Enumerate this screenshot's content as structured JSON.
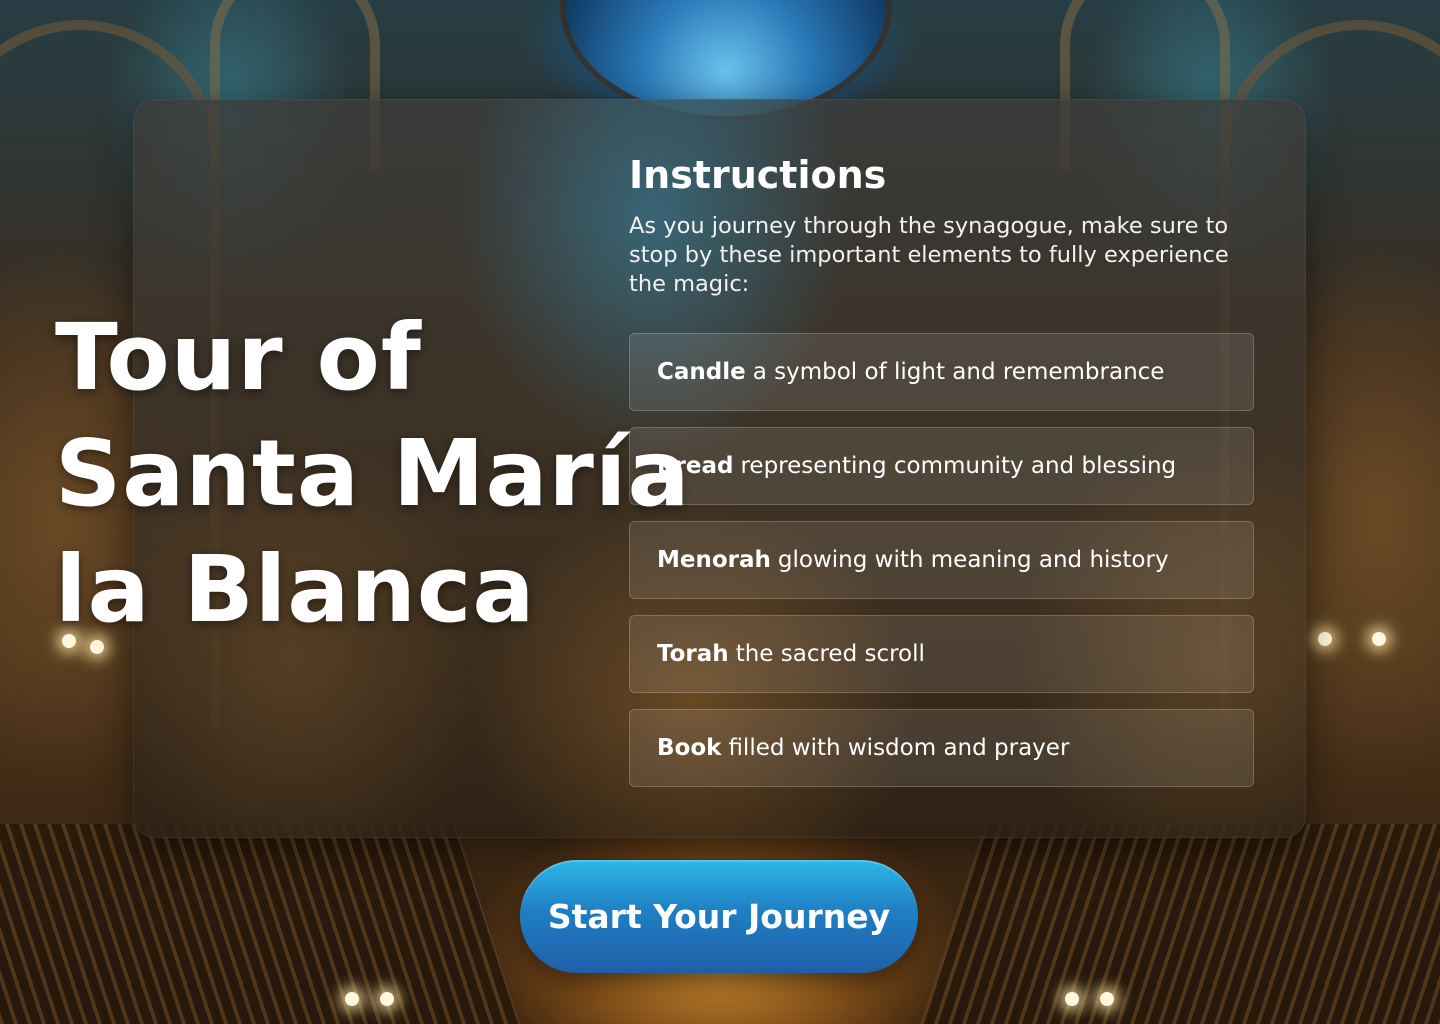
{
  "page": {
    "title_lines": [
      "Tour of",
      "Santa María",
      "la Blanca"
    ]
  },
  "instructions": {
    "heading": "Instructions",
    "text": "As you journey through the synagogue, make sure to stop by these important elements to fully experience the magic:",
    "items": [
      {
        "name": "Candle",
        "description": "a symbol of light and remembrance"
      },
      {
        "name": "Bread",
        "description": "representing community and blessing"
      },
      {
        "name": "Menorah",
        "description": "glowing with meaning and history"
      },
      {
        "name": "Torah",
        "description": "the sacred scroll"
      },
      {
        "name": "Book",
        "description": "filled with wisdom and prayer"
      }
    ]
  },
  "cta": {
    "label": "Start Your Journey"
  },
  "colors": {
    "button_top": "#2eb6e6",
    "button_bottom": "#1f5ea8",
    "text": "#ffffff"
  }
}
